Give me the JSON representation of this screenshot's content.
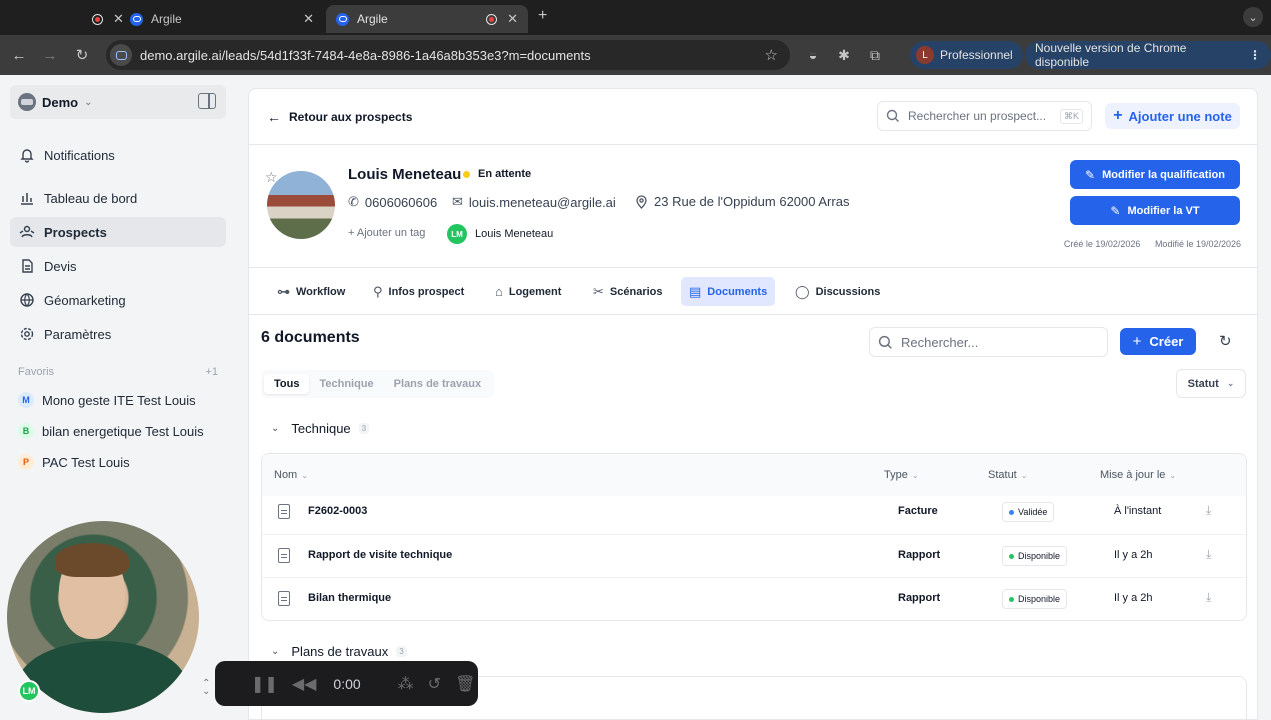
{
  "browser": {
    "tabs": [
      {
        "title": ""
      },
      {
        "title": "Argile"
      },
      {
        "title": "Argile"
      }
    ],
    "url_host": "demo.argile.ai",
    "url_path": "/leads/54d1f33f-7484-4e8a-8986-1a46a8b353e3?m=documents",
    "profile_initial": "L",
    "profile_label": "Professionnel",
    "update_label": "Nouvelle version de Chrome disponible"
  },
  "sidebar": {
    "workspace": "Demo",
    "items": [
      {
        "label": "Notifications",
        "icon": "bell-icon"
      },
      {
        "label": "Tableau de bord",
        "icon": "chart-icon"
      },
      {
        "label": "Prospects",
        "icon": "users-icon"
      },
      {
        "label": "Devis",
        "icon": "document-icon"
      },
      {
        "label": "Géomarketing",
        "icon": "globe-icon"
      },
      {
        "label": "Paramètres",
        "icon": "gear-icon"
      }
    ],
    "favorites_label": "Favoris",
    "favorites_more": "+1",
    "favorites": [
      {
        "initial": "M",
        "label": "Mono geste ITE Test Louis",
        "bg": "#dbeafe",
        "fg": "#2563eb"
      },
      {
        "initial": "B",
        "label": "bilan energetique Test Louis",
        "bg": "#dcfce7",
        "fg": "#16a34a"
      },
      {
        "initial": "P",
        "label": "PAC Test Louis",
        "bg": "#ffedd5",
        "fg": "#ea580c"
      }
    ]
  },
  "recorder": {
    "time": "0:00",
    "avatar_initials": "LM"
  },
  "topbar": {
    "back_label": "Retour aux prospects",
    "search_placeholder": "Rechercher un prospect...",
    "search_shortcut": "⌘K",
    "add_note_label": "Ajouter une note"
  },
  "lead": {
    "name": "Louis Meneteau",
    "status": "En attente",
    "phone": "0606060606",
    "email": "louis.meneteau@argile.ai",
    "address": "23 Rue de l'Oppidum 62000 Arras",
    "add_tag_label": "Ajouter un tag",
    "owner_initials": "LM",
    "owner_name": "Louis Meneteau",
    "btn_qualification": "Modifier la qualification",
    "btn_vt": "Modifier la VT",
    "created": "Créé le 19/02/2026",
    "modified": "Modifié le 19/02/2026"
  },
  "tabs": [
    {
      "label": "Workflow",
      "icon": "workflow-icon"
    },
    {
      "label": "Infos prospect",
      "icon": "person-icon"
    },
    {
      "label": "Logement",
      "icon": "house-icon"
    },
    {
      "label": "Scénarios",
      "icon": "tools-icon"
    },
    {
      "label": "Documents",
      "icon": "document-icon",
      "active": true
    },
    {
      "label": "Discussions",
      "icon": "chat-icon"
    }
  ],
  "documents": {
    "title": "6 documents",
    "search_placeholder": "Rechercher...",
    "create_label": "Créer",
    "filters": [
      "Tous",
      "Technique",
      "Plans de travaux"
    ],
    "status_filter": "Statut",
    "columns": [
      "Nom",
      "Type",
      "Statut",
      "Mise à jour le"
    ],
    "groups": [
      {
        "name": "Technique",
        "count": "3",
        "rows": [
          {
            "name": "F2602-0003",
            "type": "Facture",
            "status": "Validée",
            "status_color": "#3b82f6",
            "updated": "À l'instant"
          },
          {
            "name": "Rapport de visite technique",
            "type": "Rapport",
            "status": "Disponible",
            "status_color": "#22c55e",
            "updated": "Il y a 2h"
          },
          {
            "name": "Bilan thermique",
            "type": "Rapport",
            "status": "Disponible",
            "status_color": "#22c55e",
            "updated": "Il y a 2h"
          }
        ]
      },
      {
        "name": "Plans de travaux",
        "count": "3",
        "rows": []
      }
    ]
  },
  "colors": {
    "accent": "#2563eb",
    "status_pending": "#facc15"
  }
}
